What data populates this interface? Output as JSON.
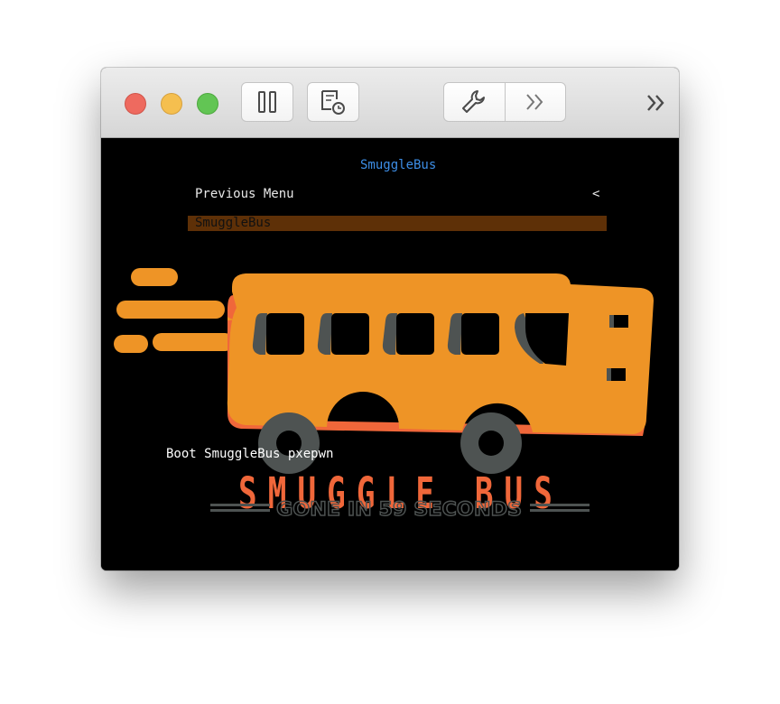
{
  "toolbar": {
    "buttons": [
      {
        "id": "traffic-close",
        "icon": "close-light"
      },
      {
        "id": "traffic-minimize",
        "icon": "minimize-light"
      },
      {
        "id": "traffic-zoom",
        "icon": "zoom-light"
      },
      {
        "id": "pause",
        "icon": "pause-icon"
      },
      {
        "id": "snapshot",
        "icon": "snapshot-icon"
      },
      {
        "id": "settings",
        "icon": "wrench-icon"
      },
      {
        "id": "forward",
        "icon": "double-chevron-icon"
      },
      {
        "id": "overflow",
        "icon": "double-chevron-icon"
      }
    ]
  },
  "boot_menu": {
    "title": "SmuggleBus",
    "previous": "Previous Menu",
    "previous_arrow": "<",
    "selected": "SmuggleBus",
    "boot_entry": "Boot SmuggleBus pxepwn"
  },
  "logo": {
    "name": "SMUGGLE BUS",
    "tagline": "GONE IN 59 SECONDS"
  },
  "colors": {
    "bus_orange": "#EE9426",
    "accent_red": "#F0673A",
    "bus_gray": "#4E5352",
    "menu_title": "#3D8EE6",
    "selection": "#5E3007"
  }
}
